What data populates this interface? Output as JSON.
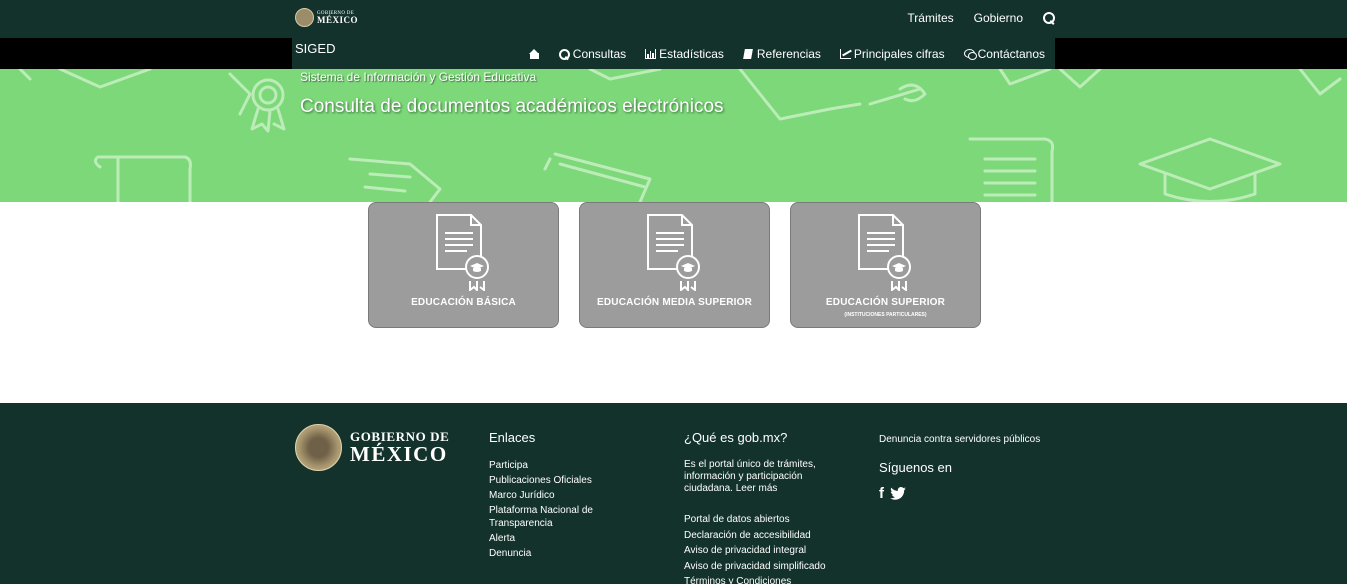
{
  "topbar": {
    "logo_line1": "GOBIERNO DE",
    "logo_line2": "MÉXICO",
    "links": [
      "Trámites",
      "Gobierno"
    ]
  },
  "nav": {
    "brand": "SIGED",
    "items": [
      {
        "label": "",
        "icon": "home-icon"
      },
      {
        "label": "Consultas",
        "icon": "search-icon"
      },
      {
        "label": "Estadísticas",
        "icon": "bar-chart-icon"
      },
      {
        "label": "Referencias",
        "icon": "book-icon"
      },
      {
        "label": "Principales cifras",
        "icon": "line-chart-icon"
      },
      {
        "label": "Contáctanos",
        "icon": "chat-icon"
      }
    ]
  },
  "banner": {
    "subtitle": "Sistema de Información y Gestión Educativa",
    "title": "Consulta de documentos académicos electrónicos"
  },
  "cards": [
    {
      "label": "EDUCACIÓN BÁSICA",
      "note": ""
    },
    {
      "label": "EDUCACIÓN MEDIA SUPERIOR",
      "note": ""
    },
    {
      "label": "EDUCACIÓN SUPERIOR",
      "note": "(INSTITUCIONES PARTICULARES)"
    }
  ],
  "footer": {
    "logo_line1": "GOBIERNO DE",
    "logo_line2": "MÉXICO",
    "enlaces": {
      "title": "Enlaces",
      "items": [
        "Participa",
        "Publicaciones Oficiales",
        "Marco Jurídico",
        "Plataforma Nacional de Transparencia",
        "Alerta",
        "Denuncia"
      ]
    },
    "que_es": {
      "title": "¿Qué es gob.mx?",
      "text": "Es el portal único de trámites, información y participación ciudadana. Leer más",
      "items": [
        "Portal de datos abiertos",
        "Declaración de accesibilidad",
        "Aviso de privacidad integral",
        "Aviso de privacidad simplificado",
        "Términos y Condiciones"
      ]
    },
    "denuncia": "Denuncia contra servidores públicos",
    "siguenos": "Síguenos en"
  },
  "colors": {
    "dark_green": "#13322b",
    "banner_green": "#7cd879",
    "card_gray": "#9c9c9c"
  }
}
